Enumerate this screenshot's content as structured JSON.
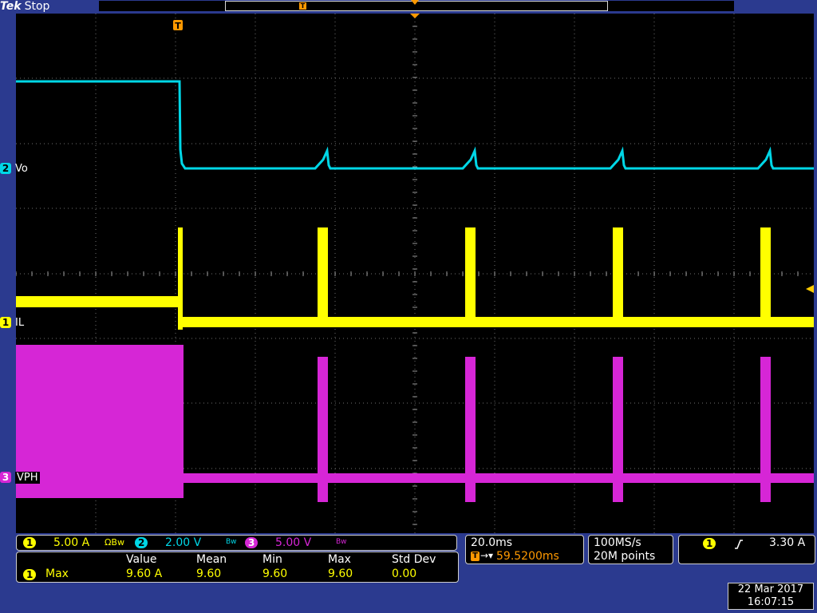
{
  "header": {
    "brand": "Tek",
    "status": "Stop"
  },
  "trigger_marker_label": "T",
  "channels": [
    {
      "num": "2",
      "label": "Vo",
      "color": "#00d7e7"
    },
    {
      "num": "1",
      "label": "IL",
      "color": "#ffff00"
    },
    {
      "num": "3",
      "label": "VPH",
      "color": "#d626d6"
    }
  ],
  "scales": {
    "ch1": {
      "num": "1",
      "value": "5.00 A",
      "suffix": "ΩBw"
    },
    "ch2": {
      "num": "2",
      "value": "2.00 V",
      "suffix": "Bw"
    },
    "ch3": {
      "num": "3",
      "value": "5.00 V",
      "suffix": "Bw"
    }
  },
  "timebase": {
    "per_div": "20.0ms",
    "trigger_pos": "59.5200ms"
  },
  "acquisition": {
    "rate": "100MS/s",
    "points": "20M points"
  },
  "trigger": {
    "source": "1",
    "level": "3.30 A"
  },
  "measurements": {
    "headers": [
      "Value",
      "Mean",
      "Min",
      "Max",
      "Std Dev"
    ],
    "row": {
      "channel": "1",
      "name": "Max",
      "value": "9.60 A",
      "mean": "9.60",
      "min": "9.60",
      "max": "9.60",
      "std": "0.00"
    }
  },
  "datetime": {
    "date": "22 Mar 2017",
    "time": "16:07:15"
  },
  "colors": {
    "ch1": "#ffff00",
    "ch2": "#00d7e7",
    "ch3": "#d626d6",
    "trigger": "#ff9900",
    "grid": "#888888"
  }
}
